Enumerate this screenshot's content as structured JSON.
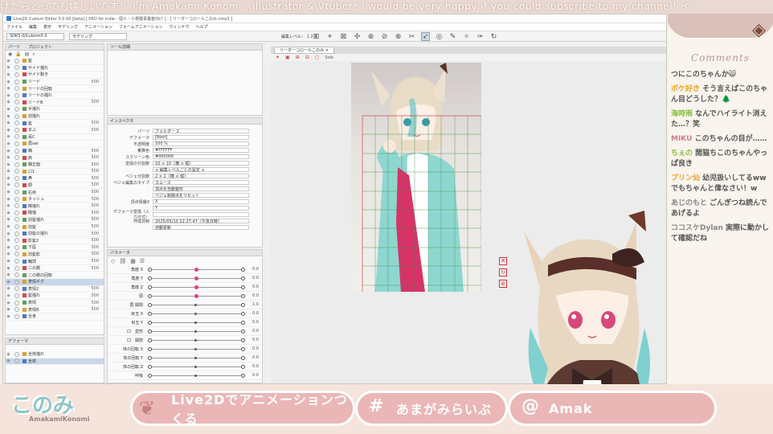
{
  "ticker": "けたらとっても嬉しいです！ I'm Amakami Konomi , illustrator & Vtuber* I would be very happy if you could subscribe to my channel!  イ",
  "window": {
    "title": "Live2D Cubism Editor 5.0.00 [beta]  [ PRO for indie - 個人・小規模事業者向け ] - [ リーダーコロールこのみ.cmo3 ]"
  },
  "menu": [
    "ファイル",
    "編集",
    "表示",
    "モデリング",
    "アニメーション",
    "フォームアニメーション",
    "ウィンドウ",
    "ヘルプ"
  ],
  "toolbar": {
    "profile": "SDK5.0/Cubism5.0",
    "mode": "モデリング",
    "level_label": "編集レベル：",
    "levels": [
      "1",
      "2",
      "3"
    ]
  },
  "parts": {
    "tabs": [
      "パーツ",
      "プロジェクト"
    ],
    "rows": [
      {
        "label": "髪",
        "val": ""
      },
      {
        "label": "サイド揺れ",
        "val": ""
      },
      {
        "label": "サイド動き",
        "val": ""
      },
      {
        "label": "リード",
        "val": "500"
      },
      {
        "label": "リードの回転",
        "val": ""
      },
      {
        "label": "リードの揺れ",
        "val": ""
      },
      {
        "label": "リードB",
        "val": "500"
      },
      {
        "label": "手揺れ",
        "val": ""
      },
      {
        "label": "前揺れ",
        "val": ""
      },
      {
        "label": "髪",
        "val": "500"
      },
      {
        "label": "まぶ",
        "val": "500"
      },
      {
        "label": "耳C",
        "val": ""
      },
      {
        "label": "眉ver",
        "val": ""
      },
      {
        "label": "胸",
        "val": "500"
      },
      {
        "label": "肩",
        "val": "500"
      },
      {
        "label": "胸正面",
        "val": "500"
      },
      {
        "label": "口1",
        "val": "500"
      },
      {
        "label": "鼻",
        "val": "500"
      },
      {
        "label": "顔",
        "val": "500"
      },
      {
        "label": "右目",
        "val": "500"
      },
      {
        "label": "タッシュ",
        "val": "500"
      },
      {
        "label": "瞳揺れ",
        "val": "500"
      },
      {
        "label": "瞳揺",
        "val": "500"
      },
      {
        "label": "前髪揺れ",
        "val": "500"
      },
      {
        "label": "前髪",
        "val": "500"
      },
      {
        "label": "前髪の揺れ",
        "val": "500"
      },
      {
        "label": "影髪2",
        "val": "500"
      },
      {
        "label": "下唇",
        "val": "500"
      },
      {
        "label": "前髪影",
        "val": "500"
      },
      {
        "label": "輪郭",
        "val": "500"
      },
      {
        "label": "二の腕",
        "val": "500"
      },
      {
        "label": "二の腕の回転",
        "val": ""
      },
      {
        "label": "表情ギグ",
        "val": ""
      },
      {
        "label": "表情2",
        "val": "500"
      },
      {
        "label": "髪揺れ",
        "val": "500"
      },
      {
        "label": "表情",
        "val": "500"
      },
      {
        "label": "表情B",
        "val": "500"
      },
      {
        "label": "全身",
        "val": ""
      }
    ]
  },
  "deformer": {
    "tab": "デフォーマ",
    "rows": [
      {
        "label": "全体揺れ"
      },
      {
        "label": "全体"
      }
    ]
  },
  "toolpanel": {
    "tab": "ツール詳細"
  },
  "inspector": {
    "tab": "インスペクタ",
    "fields": [
      {
        "label": "パーツ",
        "value": "フォルダー 2"
      },
      {
        "label": "デフォーマ",
        "value": "[Root]"
      },
      {
        "label": "不透明度",
        "value": "100 %"
      },
      {
        "label": "乗算色",
        "value": "#FFFFFF"
      },
      {
        "label": "スクリーン色",
        "value": "#000000"
      },
      {
        "label": "変換の分割数",
        "value": "10  ×  10（横 × 縦）"
      },
      {
        "label": "",
        "value": "+ 編集レベルごとの設定 +"
      },
      {
        "label": "ベジェ分割数",
        "value": "2  ×  2（横 × 縦）"
      },
      {
        "label": "ベジェ編集のタイプ",
        "value": "スムース"
      },
      {
        "label": "",
        "value": "頂点を自動整形"
      },
      {
        "label": "",
        "value": "ベジェ制御点をリセット"
      },
      {
        "label": "頂点情報X",
        "value": "X"
      },
      {
        "label": "",
        "value": "Y"
      },
      {
        "label": "デフォーマ変換（入力方式）",
        "value": ""
      },
      {
        "label": "作成日時",
        "value": "2025/05/10 22:27:47（午後日時）"
      },
      {
        "label": "",
        "value": "自動更新"
      }
    ]
  },
  "params": {
    "tab": "パラメータ",
    "rows": [
      {
        "label": "角度 X",
        "value": "0.0"
      },
      {
        "label": "角度 Y",
        "value": "0.0"
      },
      {
        "label": "角度 Z",
        "value": "0.0"
      },
      {
        "label": "頭",
        "value": "0.0"
      },
      {
        "label": "眉 開閉",
        "value": "1.0"
      },
      {
        "label": "目玉 X",
        "value": "0.0"
      },
      {
        "label": "目玉 Y",
        "value": "0.0"
      },
      {
        "label": "口　変形",
        "value": "0.0"
      },
      {
        "label": "口　開閉",
        "value": "0.0"
      },
      {
        "label": "体の回転 X",
        "value": "0.0"
      },
      {
        "label": "体の回転 Y",
        "value": "0.0"
      },
      {
        "label": "体の回転 Z",
        "value": "0.0"
      },
      {
        "label": "呼吸",
        "value": "0.0"
      }
    ]
  },
  "canvas": {
    "tab": "リーダーコロールこのみ",
    "zoom": "Solo"
  },
  "chat": {
    "title": "Comments",
    "messages": [
      {
        "user": "",
        "text": "つにこのちゃんか😸"
      },
      {
        "user": "ポケ好き",
        "text": "そう言えばこのちゃん目どうした？🌲"
      },
      {
        "user": "海時雨",
        "text": "なんでハイライト消えた…？笑"
      },
      {
        "user": "MIKU",
        "text": "このちゃんの目が……"
      },
      {
        "user": "ちぇの",
        "text": "閲猫ちこのちゃんやっぱ良き"
      },
      {
        "user": "プリン仙",
        "text": "幼児扱いしてるwwでもちゃんと偉なさい！w"
      },
      {
        "user": "あじのもと",
        "text": "ごんぎつね読んであげるよ"
      },
      {
        "user": "ココスケDylan",
        "text": "実際に動かして確認だね"
      }
    ]
  },
  "bottom": {
    "logo": "このみ",
    "logo_sub": "AmakamiKonomi",
    "banners": [
      "Live2Dでアニメーションつくる",
      "あまがみらいぶ",
      "Amak"
    ],
    "banner_icons": [
      "#",
      "@"
    ]
  }
}
